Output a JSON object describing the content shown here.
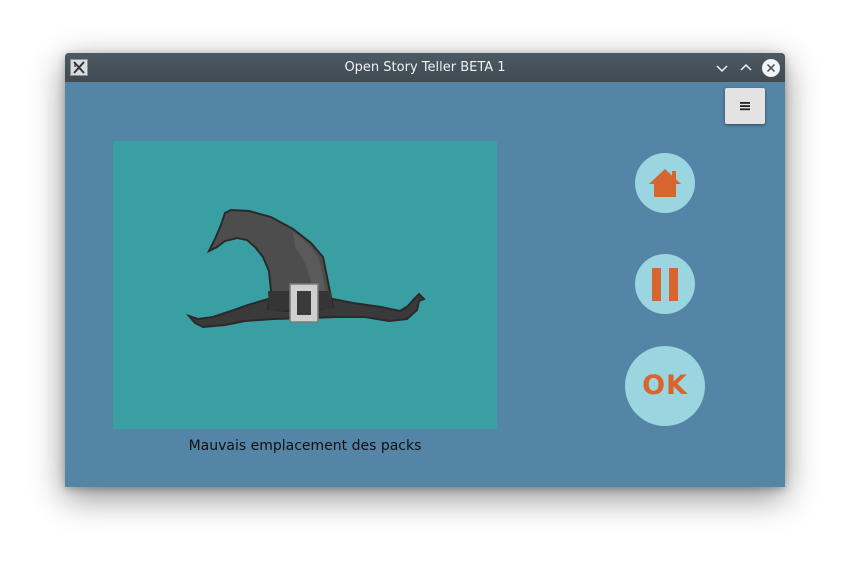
{
  "window": {
    "title": "Open Story Teller BETA 1",
    "icons": {
      "app": "app-x-icon",
      "minimize": "chevron-down-icon",
      "maximize": "chevron-up-icon",
      "close": "close-circle-icon"
    }
  },
  "toolbar": {
    "menu_icon": "hamburger-icon"
  },
  "story": {
    "image": "witch-hat",
    "caption": "Mauvais emplacement des packs"
  },
  "controls": {
    "home_icon": "home-icon",
    "pause_icon": "pause-icon",
    "ok_label": "OK"
  },
  "colors": {
    "background": "#5585a6",
    "image_bg": "#399fa2",
    "button_bg": "#9bd5e0",
    "accent": "#d8652e",
    "titlebar": "#46525a"
  }
}
